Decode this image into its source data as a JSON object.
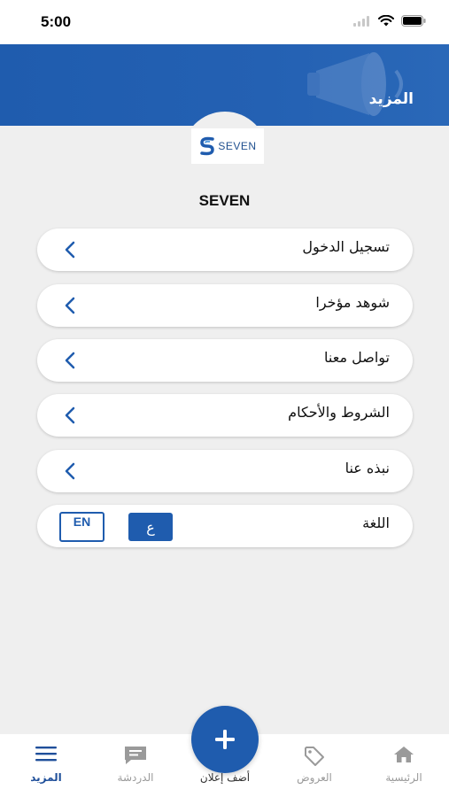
{
  "status_bar": {
    "time": "5:00"
  },
  "header": {
    "title": "المزيد"
  },
  "logo": {
    "text": "SEVEN"
  },
  "brand": {
    "name": "SEVEN"
  },
  "menu": {
    "items": [
      {
        "label": "تسجيل الدخول"
      },
      {
        "label": "شوهد مؤخرا"
      },
      {
        "label": "تواصل معنا"
      },
      {
        "label": "الشروط والأحكام"
      },
      {
        "label": "نبذه عنا"
      }
    ],
    "language": {
      "label": "اللغة",
      "ar": "ع",
      "en": "EN",
      "selected": "ar"
    }
  },
  "tabbar": {
    "home": "الرئيسية",
    "offers": "العروض",
    "add_ad": "أضف إعلان",
    "chat": "الدردشة",
    "more": "المزيد",
    "active": "more"
  },
  "colors": {
    "primary": "#1f5cae",
    "background": "#efefef",
    "active_tab": "#1f4f9a",
    "inactive_tab": "#9a9a9a"
  }
}
